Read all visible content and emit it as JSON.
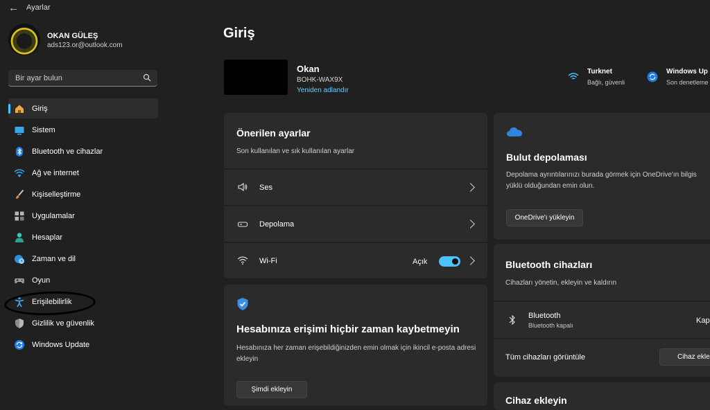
{
  "titlebar": {
    "title": "Ayarlar"
  },
  "profile": {
    "name": "OKAN GÜLEŞ",
    "email": "ads123.or@outlook.com"
  },
  "search": {
    "placeholder": "Bir ayar bulun"
  },
  "nav": [
    {
      "label": "Giriş",
      "icon": "home-icon",
      "active": true
    },
    {
      "label": "Sistem",
      "icon": "system-icon"
    },
    {
      "label": "Bluetooth ve cihazlar",
      "icon": "bluetooth-icon"
    },
    {
      "label": "Ağ ve internet",
      "icon": "network-icon"
    },
    {
      "label": "Kişiselleştirme",
      "icon": "brush-icon"
    },
    {
      "label": "Uygulamalar",
      "icon": "apps-icon"
    },
    {
      "label": "Hesaplar",
      "icon": "accounts-icon"
    },
    {
      "label": "Zaman ve dil",
      "icon": "time-language-icon"
    },
    {
      "label": "Oyun",
      "icon": "gaming-icon"
    },
    {
      "label": "Erişilebilirlik",
      "icon": "accessibility-icon"
    },
    {
      "label": "Gizlilik ve güvenlik",
      "icon": "shield-icon"
    },
    {
      "label": "Windows Update",
      "icon": "windows-update-icon"
    }
  ],
  "main": {
    "title": "Giriş",
    "device": {
      "name": "Okan",
      "model": "BOHK-WAX9X",
      "rename": "Yeniden adlandır"
    },
    "status": {
      "network": {
        "title": "Turknet",
        "sub": "Bağlı, güvenli"
      },
      "update": {
        "title": "Windows Up",
        "sub": "Son denetleme"
      }
    },
    "recommended": {
      "title": "Önerilen ayarlar",
      "subtitle": "Son kullanılan ve sık kullanılan ayarlar",
      "rows": [
        {
          "label": "Ses",
          "icon": "speaker-icon"
        },
        {
          "label": "Depolama",
          "icon": "storage-icon"
        },
        {
          "label": "Wi-Fi",
          "icon": "wifi-icon",
          "value": "Açık",
          "toggle_on": true
        }
      ]
    },
    "account_card": {
      "title": "Hesabınıza erişimi hiçbir zaman kaybetmeyin",
      "body": "Hesabınıza her zaman erişebildiğinizden emin olmak için ikincil e-posta adresi ekleyin",
      "button": "Şimdi ekleyin"
    },
    "cloud_card": {
      "title": "Bulut depolaması",
      "body": "Depolama ayrıntılarınızı burada görmek için OneDrive'ın bilgis yüklü olduğundan emin olun.",
      "button": "OneDrive'ı yükleyin"
    },
    "bt_card": {
      "title": "Bluetooth cihazları",
      "subtitle": "Cihazları yönetin, ekleyin ve kaldırın",
      "device_label": "Bluetooth",
      "device_sub": "Bluetooth kapalı",
      "device_state": "Kapa",
      "view_all": "Tüm cihazları görüntüle",
      "add_button": "Cihaz ekle"
    },
    "bottom_partial": "Cihaz ekleyin"
  },
  "colors": {
    "accent": "#4cc2ff",
    "link": "#60cdff",
    "background": "#202020",
    "card": "#2b2b2b"
  }
}
